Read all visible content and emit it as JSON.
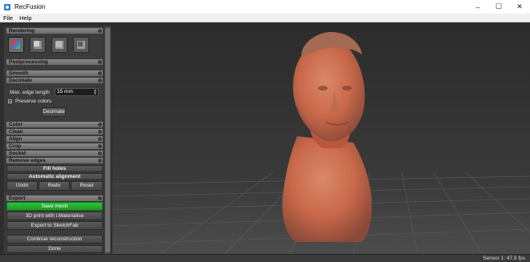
{
  "window": {
    "title": "RecFusion",
    "minimize": "–",
    "maximize": "☐",
    "close": "✕"
  },
  "menu": {
    "file": "File",
    "help": "Help"
  },
  "sections": {
    "rendering": "Rendering",
    "postprocessing": "Postprocessing",
    "smooth": "Smooth",
    "decimate": "Decimate",
    "color": "Color",
    "clean": "Clean",
    "align": "Align",
    "crop": "Crop",
    "socket": "Socket",
    "remove_edges": "Remove edges",
    "export": "Export"
  },
  "rendering_modes": [
    "color-cube-icon",
    "shaded-cube-icon",
    "flat-cube-icon",
    "wireframe-cube-icon"
  ],
  "decimate": {
    "max_edge_label": "Max. edge length",
    "max_edge_value": "15 mm",
    "preserve_colors_label": "Preserve colors",
    "preserve_colors_checked": "x",
    "button": "Decimate"
  },
  "actions": {
    "fill_holes": "Fill holes",
    "automatic_alignment": "Automatic alignment",
    "undo": "Undo",
    "redo": "Redo",
    "reset": "Reset"
  },
  "export": {
    "save_mesh": "Save mesh",
    "print": "3D print with i.Materialise",
    "sketchfab": "Export to SketchFab"
  },
  "bottom": {
    "continue": "Continue reconstruction",
    "done": "Done"
  },
  "status": {
    "sensor": "Sensor 1: 47.9 fps"
  },
  "colors": {
    "accent_green": "#22b030",
    "panel": "#3b3b3b",
    "viewport": "#333333",
    "mesh": "#c9684a"
  }
}
